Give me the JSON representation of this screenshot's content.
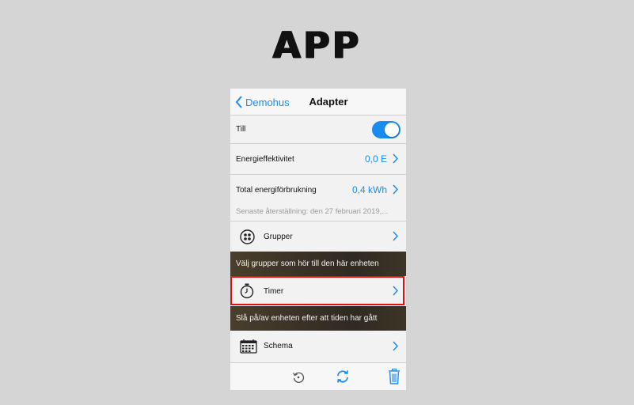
{
  "page_title": "APP",
  "nav": {
    "back_label": "Demohus",
    "title": "Adapter"
  },
  "settings": {
    "power": {
      "label": "Till",
      "on": true
    },
    "energy_efficiency": {
      "label": "Energieffektivitet",
      "value": "0,0 E"
    },
    "total_consumption": {
      "label": "Total energiförbrukning",
      "value": "0,4 kWh",
      "note": "Senaste återställning: den 27 februari 2019,..."
    }
  },
  "items": {
    "groups": {
      "label": "Grupper",
      "icon": "groups-icon",
      "description": "Välj grupper som hör till den här enheten"
    },
    "timer": {
      "label": "Timer",
      "icon": "stopwatch-icon",
      "description": "Slå på/av enheten efter att tiden har gått"
    },
    "schedule": {
      "label": "Schema",
      "icon": "calendar-icon"
    }
  },
  "toolbar": {
    "icons": [
      "reset-icon",
      "refresh-icon",
      "trash-icon"
    ]
  },
  "colors": {
    "accent": "#1a8cf0",
    "highlight": "#e01010",
    "background": "#d5d5d5"
  }
}
